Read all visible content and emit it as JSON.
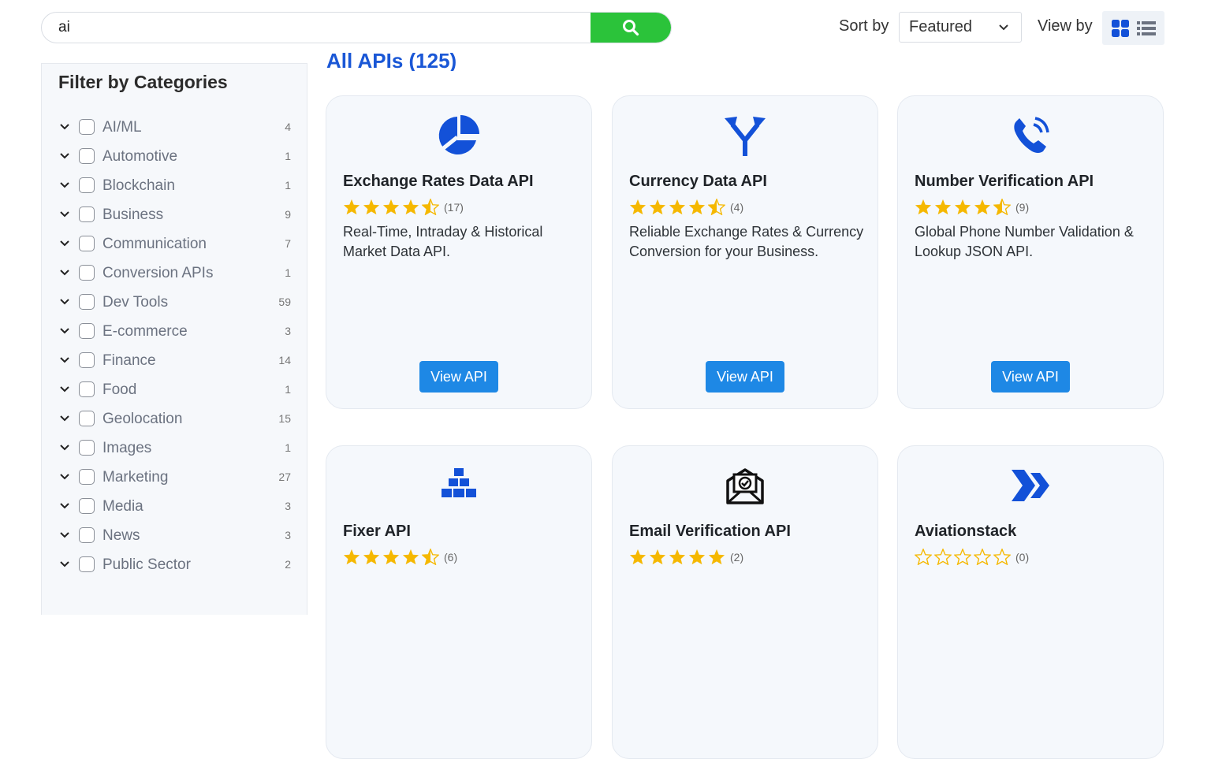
{
  "search": {
    "value": "ai",
    "button_icon": "search-icon"
  },
  "sort": {
    "label": "Sort by",
    "selected": "Featured"
  },
  "view": {
    "label": "View by",
    "modes": [
      "grid-icon",
      "list-icon"
    ],
    "active": "grid"
  },
  "sidebar": {
    "title": "Filter by Categories",
    "items": [
      {
        "label": "AI/ML",
        "count": "4"
      },
      {
        "label": "Automotive",
        "count": "1"
      },
      {
        "label": "Blockchain",
        "count": "1"
      },
      {
        "label": "Business",
        "count": "9"
      },
      {
        "label": "Communication",
        "count": "7"
      },
      {
        "label": "Conversion APIs",
        "count": "1"
      },
      {
        "label": "Dev Tools",
        "count": "59"
      },
      {
        "label": "E-commerce",
        "count": "3"
      },
      {
        "label": "Finance",
        "count": "14"
      },
      {
        "label": "Food",
        "count": "1"
      },
      {
        "label": "Geolocation",
        "count": "15"
      },
      {
        "label": "Images",
        "count": "1"
      },
      {
        "label": "Marketing",
        "count": "27"
      },
      {
        "label": "Media",
        "count": "3"
      },
      {
        "label": "News",
        "count": "3"
      },
      {
        "label": "Public Sector",
        "count": "2"
      }
    ]
  },
  "results": {
    "heading": "All APIs (125)"
  },
  "colors": {
    "accent": "#1e88e5",
    "search_button": "#2bc33a",
    "star": "#f5b800",
    "icon_blue": "#1351d8"
  },
  "cards": [
    {
      "title": "Exchange Rates Data API",
      "rating": 4.5,
      "count": "(17)",
      "desc": "Real-Time, Intraday & Historical Market Data API.",
      "button": "View API",
      "icon": "pie-chart-icon"
    },
    {
      "title": "Currency Data API",
      "rating": 4.5,
      "count": "(4)",
      "desc": "Reliable Exchange Rates & Currency Conversion for your Business.",
      "button": "View API",
      "icon": "split-arrows-icon"
    },
    {
      "title": "Number Verification API",
      "rating": 4.5,
      "count": "(9)",
      "desc": "Global Phone Number Validation & Lookup JSON API.",
      "button": "View API",
      "icon": "phone-icon"
    },
    {
      "title": "Fixer API",
      "rating": 4.5,
      "count": "(6)",
      "desc": "",
      "button": "",
      "icon": "gold-bars-icon"
    },
    {
      "title": "Email Verification API",
      "rating": 5,
      "count": "(2)",
      "desc": "",
      "button": "",
      "icon": "email-verify-icon"
    },
    {
      "title": "Aviationstack",
      "rating": 0,
      "count": "(0)",
      "desc": "",
      "button": "",
      "icon": "chevrons-icon"
    }
  ]
}
